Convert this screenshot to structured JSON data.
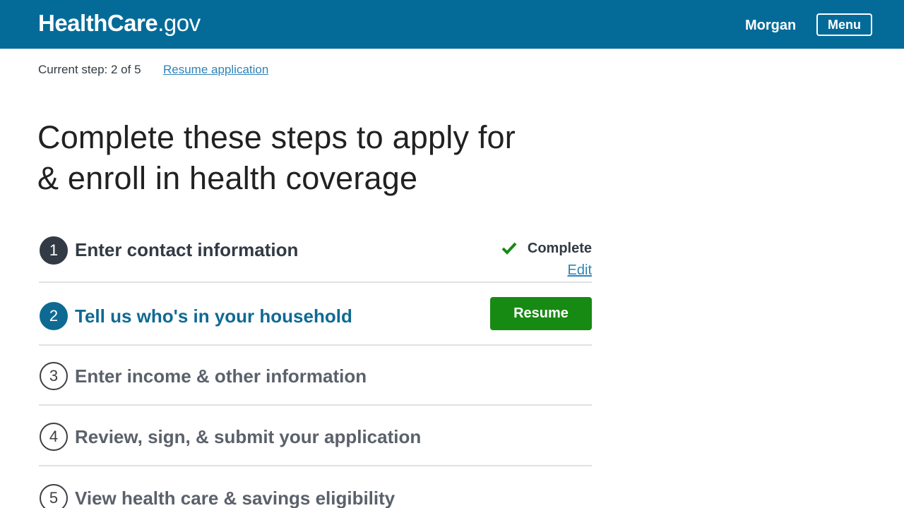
{
  "header": {
    "logo_bold": "HealthCare",
    "logo_thin": ".gov",
    "user_name": "Morgan",
    "menu_label": "Menu"
  },
  "progress": {
    "current_step_text": "Current step: 2 of 5",
    "resume_link": "Resume application"
  },
  "page_title": "Complete these steps to apply for & enroll in health coverage",
  "steps": [
    {
      "number": "1",
      "label": "Enter contact information",
      "status": "Complete",
      "edit_label": "Edit"
    },
    {
      "number": "2",
      "label": "Tell us who's in your household",
      "button_label": "Resume"
    },
    {
      "number": "3",
      "label": "Enter income & other information"
    },
    {
      "number": "4",
      "label": "Review, sign, & submit your application"
    },
    {
      "number": "5",
      "label": "View health care & savings eligibility"
    }
  ],
  "colors": {
    "header_bg": "#046b99",
    "link": "#2e83b7",
    "active_step": "#0f6a93",
    "resume_button": "#178a13",
    "check": "#178a13"
  }
}
